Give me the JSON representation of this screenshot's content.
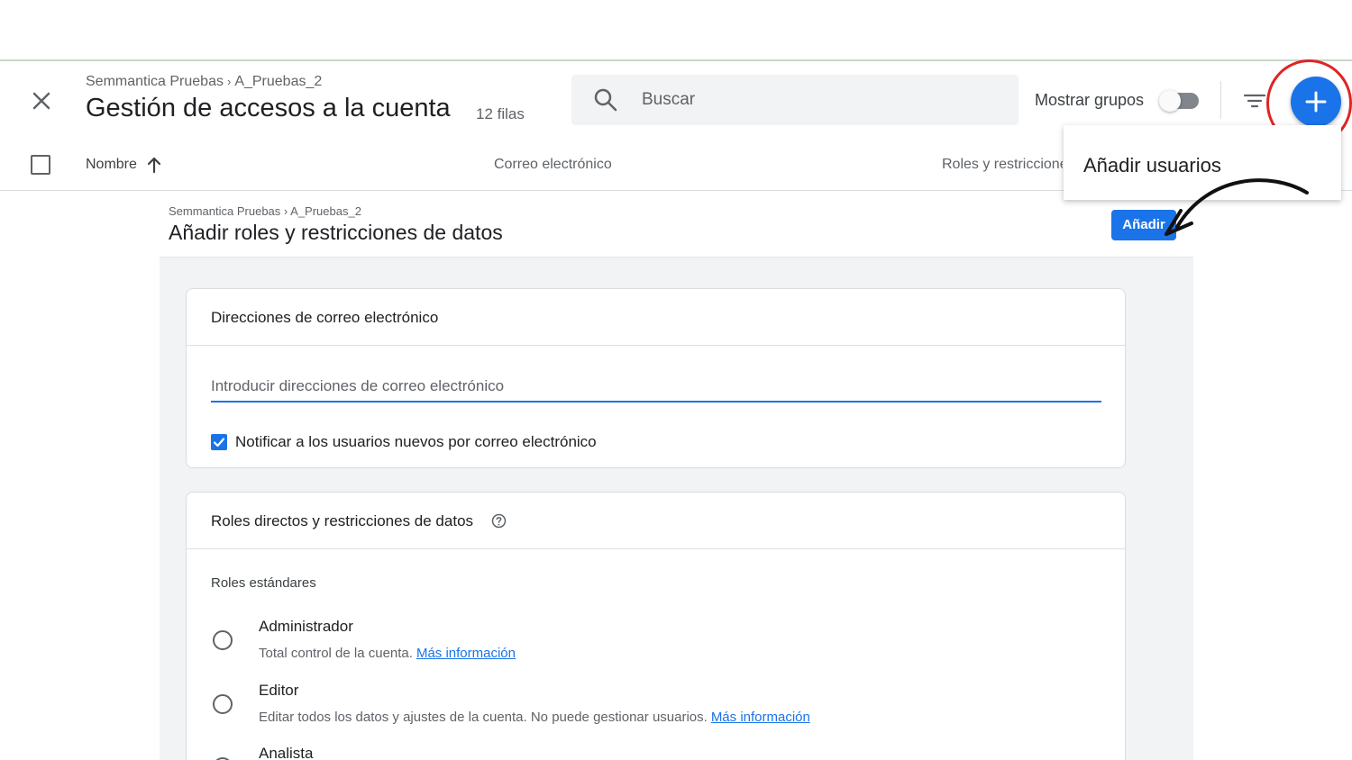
{
  "header": {
    "breadcrumb": [
      "Semmantica Pruebas",
      "A_Pruebas_2"
    ],
    "breadcrumb_separator": "›",
    "title": "Gestión de accesos a la cuenta",
    "row_count": "12 filas",
    "search_placeholder": "Buscar",
    "toggle_label": "Mostrar grupos",
    "toggle_on": false
  },
  "dropdown": {
    "item": "Añadir usuarios"
  },
  "table_header": {
    "name": "Nombre",
    "email": "Correo electrónico",
    "roles": "Roles y restricciones"
  },
  "panel": {
    "breadcrumb": [
      "Semmantica Pruebas",
      "A_Pruebas_2"
    ],
    "title": "Añadir roles y restricciones de datos",
    "add_button": "Añadir"
  },
  "email_card": {
    "title": "Direcciones de correo electrónico",
    "input_placeholder": "Introducir direcciones de correo electrónico",
    "notify_label": "Notificar a los usuarios nuevos por correo electrónico",
    "notify_checked": true
  },
  "roles_card": {
    "title": "Roles directos y restricciones de datos",
    "subtitle": "Roles estándares",
    "roles": [
      {
        "name": "Administrador",
        "desc": "Total control de la cuenta.",
        "link": "Más información"
      },
      {
        "name": "Editor",
        "desc": "Editar todos los datos y ajustes de la cuenta. No puede gestionar usuarios.",
        "link": "Más información"
      },
      {
        "name": "Analista"
      }
    ]
  },
  "colors": {
    "accent": "#1a73e8",
    "annotation": "#e02424"
  },
  "icons": [
    "close-icon",
    "search-icon",
    "filter-icon",
    "plus-icon",
    "arrow-up-icon",
    "help-icon",
    "check-icon"
  ]
}
